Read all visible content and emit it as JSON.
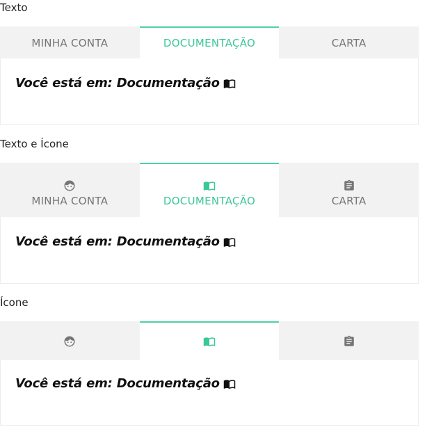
{
  "sections": [
    {
      "label": "Texto",
      "tabs": [
        {
          "label": "MINHA CONTA",
          "icon": "face-icon"
        },
        {
          "label": "DOCUMENTAÇÃO",
          "icon": "book-icon"
        },
        {
          "label": "CARTA",
          "icon": "clipboard-icon"
        }
      ],
      "active_tab": 1,
      "panel_text": "Você está em: Documentação"
    },
    {
      "label": "Texto e Ícone",
      "tabs": [
        {
          "label": "MINHA CONTA",
          "icon": "face-icon"
        },
        {
          "label": "DOCUMENTAÇÃO",
          "icon": "book-icon"
        },
        {
          "label": "CARTA",
          "icon": "clipboard-icon"
        }
      ],
      "active_tab": 1,
      "panel_text": "Você está em: Documentação"
    },
    {
      "label": "Ícone",
      "tabs": [
        {
          "icon": "face-icon"
        },
        {
          "icon": "book-icon"
        },
        {
          "icon": "clipboard-icon"
        }
      ],
      "active_tab": 1,
      "panel_text": "Você está em: Documentação"
    }
  ],
  "colors": {
    "accent": "#3cc79a",
    "accent_border": "#4fd1a5",
    "inactive_tab_bg": "#f2f2f2",
    "inactive_tab_text": "#757575",
    "panel_border": "#ececec"
  }
}
